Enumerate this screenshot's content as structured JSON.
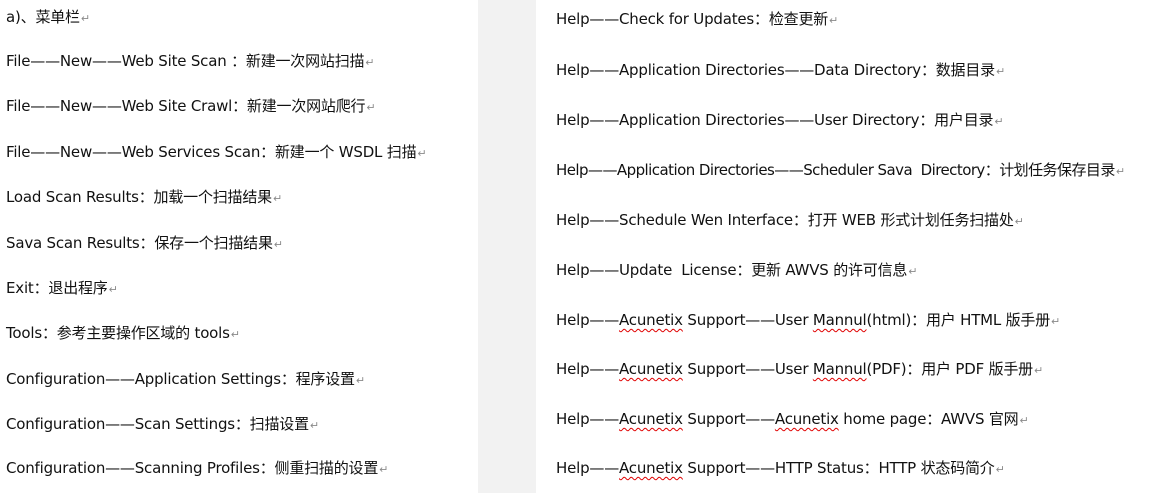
{
  "paragraph_mark": "↵",
  "left": {
    "heading": "a)、菜单栏",
    "lines": [
      "File——New——Web Site Scan ：新建一次网站扫描",
      "File——New——Web Site Crawl：新建一次网站爬行",
      "File——New——Web Services Scan：新建一个 WSDL 扫描",
      "Load Scan Results：加载一个扫描结果",
      "Sava Scan Results：保存一个扫描结果",
      "Exit：退出程序",
      "Tools：参考主要操作区域的 tools",
      "Configuration——Application Settings：程序设置",
      "Configuration——Scan Settings：扫描设置",
      "Configuration——Scanning Profiles：侧重扫描的设置"
    ]
  },
  "right": {
    "lines": [
      "Help——Check for Updates：检查更新",
      "Help——Application Directories——Data Directory：数据目录",
      "Help——Application Directories——User Directory：用户目录",
      "Help——Application Directories——Scheduler Sava  Directory：计划任务保存目录",
      "Help——Schedule Wen Interface：打开 WEB 形式计划任务扫描处",
      "Help——Update  License：更新 AWVS 的许可信息"
    ],
    "line7": {
      "a": "Help——",
      "b": "Acunetix",
      "c": " Support——User ",
      "d": "Mannul",
      "e": "(html)：用户 HTML 版手册"
    },
    "line8": {
      "a": "Help——",
      "b": "Acunetix",
      "c": " Support——User ",
      "d": "Mannul",
      "e": "(PDF)：用户 PDF 版手册"
    },
    "line9": {
      "a": "Help——",
      "b": "Acunetix",
      "c": " Support——",
      "d": "Acunetix",
      "e": " home page：AWVS 官网"
    },
    "line10": {
      "a": "Help——",
      "b": "Acunetix",
      "c": " Support——HTTP Status：HTTP 状态码简介"
    }
  }
}
